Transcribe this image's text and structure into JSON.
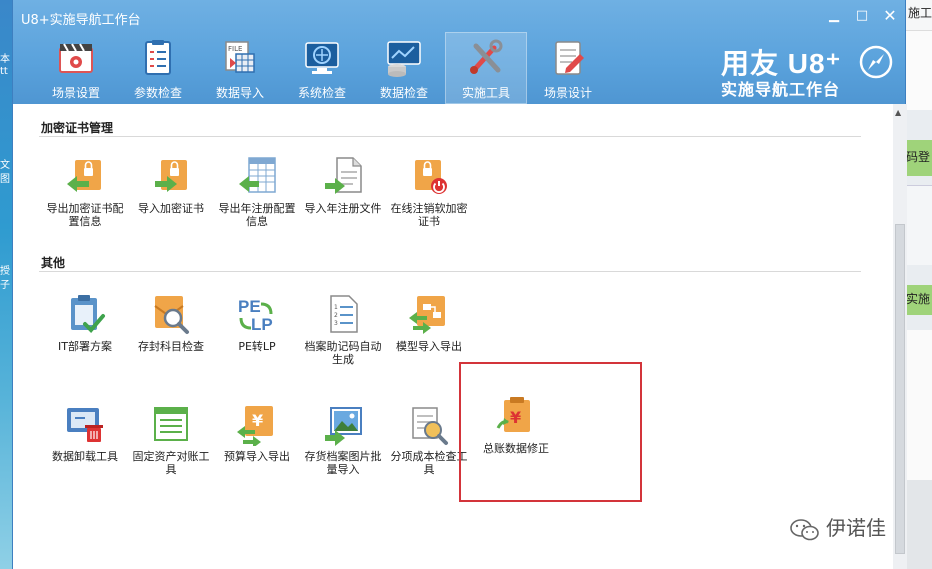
{
  "window": {
    "title": "U8+实施导航工作台",
    "min_btn": "▁",
    "max_btn": "□",
    "close_btn": "✕"
  },
  "toolbar": {
    "items": [
      {
        "label": "场景设置",
        "icon": "scene-settings-icon"
      },
      {
        "label": "参数检查",
        "icon": "parameter-check-icon"
      },
      {
        "label": "数据导入",
        "icon": "data-import-icon"
      },
      {
        "label": "系统检查",
        "icon": "system-check-icon"
      },
      {
        "label": "数据检查",
        "icon": "data-check-icon"
      },
      {
        "label": "实施工具",
        "icon": "implementation-tools-icon",
        "active": true
      },
      {
        "label": "场景设计",
        "icon": "scene-design-icon"
      }
    ]
  },
  "brand": {
    "main": "用友 U8⁺",
    "sub": "实施导航工作台"
  },
  "sections": [
    {
      "title": "加密证书管理",
      "tools": [
        {
          "label": "导出加密证书配置信息",
          "icon": "export-cert-config-icon"
        },
        {
          "label": "导入加密证书",
          "icon": "import-cert-icon"
        },
        {
          "label": "导出年注册配置信息",
          "icon": "export-annual-registration-config-icon"
        },
        {
          "label": "导入年注册文件",
          "icon": "import-annual-registration-file-icon"
        },
        {
          "label": "在线注销软加密证书",
          "icon": "online-revoke-soft-cert-icon"
        }
      ]
    },
    {
      "title": "其他",
      "tools": [
        {
          "label": "IT部署方案",
          "icon": "it-deployment-plan-icon"
        },
        {
          "label": "存封科目检查",
          "icon": "sealed-subject-check-icon"
        },
        {
          "label": "PE转LP",
          "icon": "pe-to-lp-icon"
        },
        {
          "label": "档案助记码自动生成",
          "icon": "archive-mnemonic-autogen-icon"
        },
        {
          "label": "模型导入导出",
          "icon": "model-import-export-icon"
        },
        {
          "label": "数据卸载工具",
          "icon": "data-unload-tool-icon"
        },
        {
          "label": "固定资产对账工具",
          "icon": "fixed-asset-reconcile-icon"
        },
        {
          "label": "预算导入导出",
          "icon": "budget-import-export-icon"
        },
        {
          "label": "存货档案图片批量导入",
          "icon": "inventory-image-batch-import-icon"
        },
        {
          "label": "分项成本检查工具",
          "icon": "itemized-cost-check-icon"
        },
        {
          "label": "总账数据修正",
          "icon": "general-ledger-fix-icon"
        }
      ]
    }
  ],
  "watermark": {
    "text": "伊诺佳"
  },
  "background": {
    "right_texts": [
      "施工作",
      "码登",
      "实施"
    ],
    "left_texts": [
      "本",
      "tt",
      "文",
      "图",
      "授",
      "子"
    ]
  },
  "colors": {
    "titlebar": "#5aa2dc",
    "highlight": "#d3343a",
    "icon_orange": "#f0a548",
    "icon_green": "#5bb04a"
  }
}
